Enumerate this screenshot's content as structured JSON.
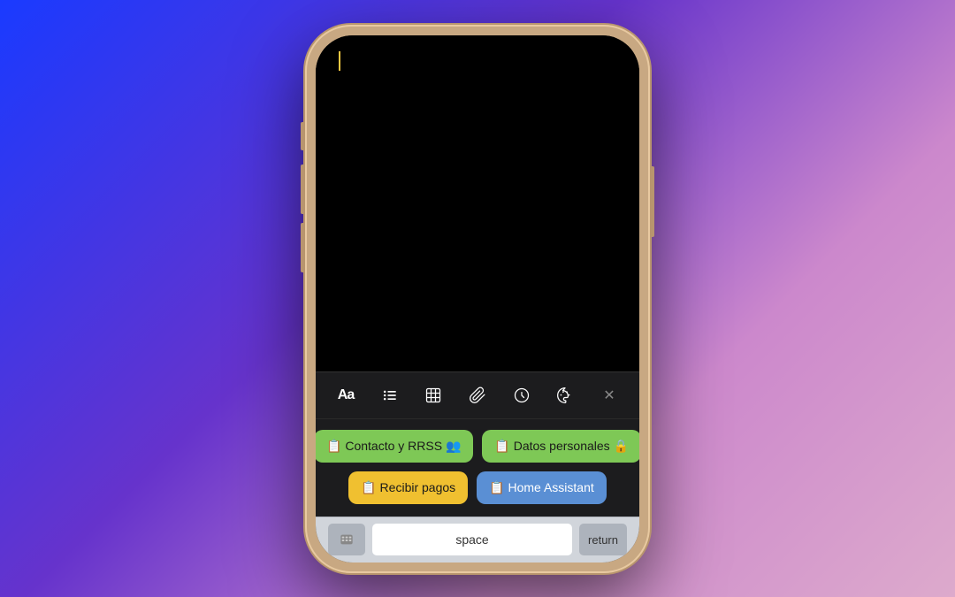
{
  "background": {
    "gradient": "blue-to-pink"
  },
  "phone": {
    "toolbar": {
      "items": [
        {
          "id": "font",
          "label": "Aa"
        },
        {
          "id": "list",
          "label": "list"
        },
        {
          "id": "table",
          "label": "table"
        },
        {
          "id": "attachment",
          "label": "attachment"
        },
        {
          "id": "circle",
          "label": "circle"
        },
        {
          "id": "palette",
          "label": "palette"
        },
        {
          "id": "close",
          "label": "×"
        }
      ]
    },
    "shortcuts": {
      "row1": [
        {
          "id": "contacto",
          "label": "📋 Contacto y RRSS 👥",
          "color": "green"
        },
        {
          "id": "datos",
          "label": "📋 Datos personales 🔒",
          "color": "green"
        }
      ],
      "row2": [
        {
          "id": "recibir",
          "label": "📋 Recibir pagos",
          "color": "yellow"
        },
        {
          "id": "home",
          "label": "📋 Home Assistant",
          "color": "blue"
        }
      ]
    },
    "keyboard": {
      "space_label": "space",
      "return_label": "return"
    }
  }
}
